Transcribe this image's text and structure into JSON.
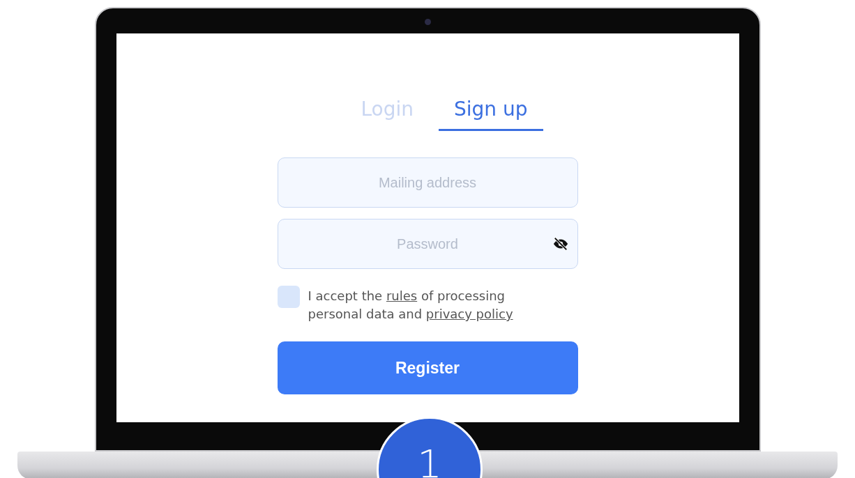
{
  "tabs": [
    {
      "label": "Login",
      "selected": false
    },
    {
      "label": "Sign up",
      "selected": true
    }
  ],
  "form": {
    "email": {
      "placeholder": "Mailing address"
    },
    "password": {
      "placeholder": "Password"
    },
    "consent": {
      "checked": false,
      "parts": [
        {
          "kind": "text",
          "text": "I accept the "
        },
        {
          "kind": "link",
          "text": "rules"
        },
        {
          "kind": "text",
          "text": " of processing personal data and "
        },
        {
          "kind": "link",
          "text": "privacy policy"
        }
      ]
    },
    "submit": "Register"
  },
  "badge": "1"
}
